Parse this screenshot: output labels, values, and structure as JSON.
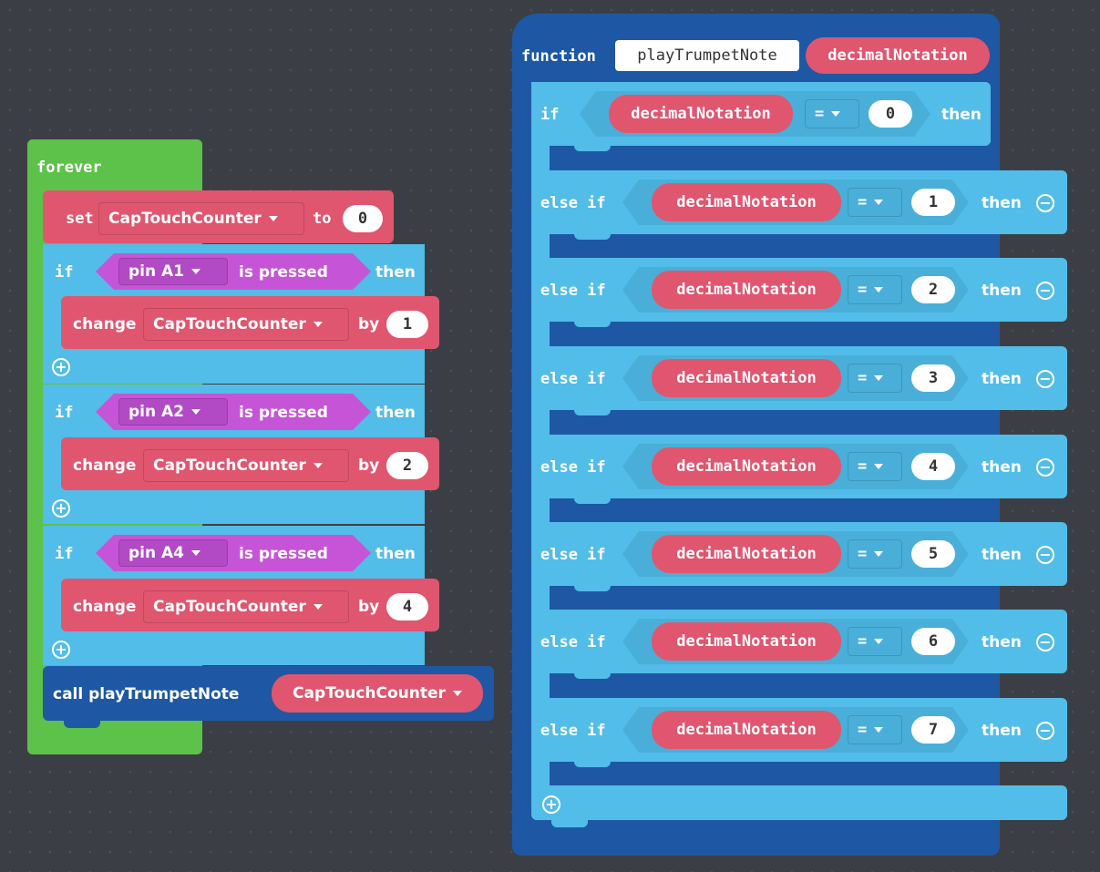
{
  "forever": {
    "label": "forever"
  },
  "set_block": {
    "keyword": "set",
    "variable": "CapTouchCounter",
    "to": "to",
    "value": "0"
  },
  "if_blocks": [
    {
      "if": "if",
      "pin": "pin A1",
      "pressed": "is pressed",
      "then": "then",
      "change": "change",
      "variable": "CapTouchCounter",
      "by": "by",
      "amount": "1"
    },
    {
      "if": "if",
      "pin": "pin A2",
      "pressed": "is pressed",
      "then": "then",
      "change": "change",
      "variable": "CapTouchCounter",
      "by": "by",
      "amount": "2"
    },
    {
      "if": "if",
      "pin": "pin A4",
      "pressed": "is pressed",
      "then": "then",
      "change": "change",
      "variable": "CapTouchCounter",
      "by": "by",
      "amount": "4"
    }
  ],
  "call_block": {
    "label": "call playTrumpetNote",
    "arg": "CapTouchCounter"
  },
  "function_block": {
    "keyword": "function",
    "name": "playTrumpetNote",
    "param": "decimalNotation"
  },
  "conditions": [
    {
      "keyword": "if",
      "var": "decimalNotation",
      "op": "=",
      "value": "0",
      "then": "then"
    },
    {
      "keyword": "else if",
      "var": "decimalNotation",
      "op": "=",
      "value": "1",
      "then": "then"
    },
    {
      "keyword": "else if",
      "var": "decimalNotation",
      "op": "=",
      "value": "2",
      "then": "then"
    },
    {
      "keyword": "else if",
      "var": "decimalNotation",
      "op": "=",
      "value": "3",
      "then": "then"
    },
    {
      "keyword": "else if",
      "var": "decimalNotation",
      "op": "=",
      "value": "4",
      "then": "then"
    },
    {
      "keyword": "else if",
      "var": "decimalNotation",
      "op": "=",
      "value": "5",
      "then": "then"
    },
    {
      "keyword": "else if",
      "var": "decimalNotation",
      "op": "=",
      "value": "6",
      "then": "then"
    },
    {
      "keyword": "else if",
      "var": "decimalNotation",
      "op": "=",
      "value": "7",
      "then": "then"
    }
  ],
  "colors": {
    "workspace": "#3b3f45",
    "loop": "#5cc24a",
    "variable": "#e0566f",
    "logic": "#52bde8",
    "function": "#1e58a4",
    "input": "#c555d6"
  }
}
